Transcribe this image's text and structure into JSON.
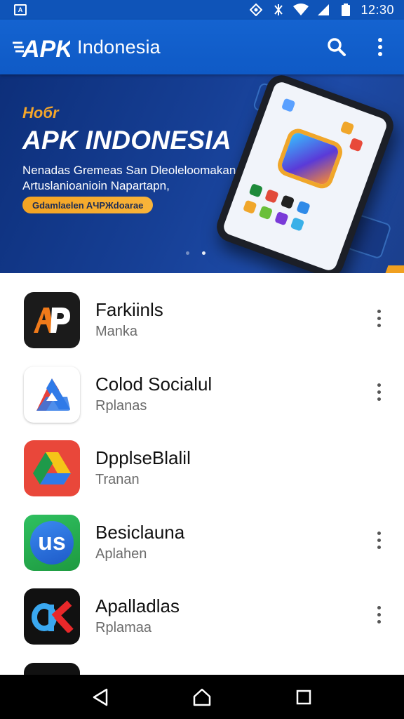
{
  "status_bar": {
    "notification_icon": "notification-icon",
    "time": "12:30",
    "icons": [
      "nfc-icon",
      "vibrate-icon",
      "wifi-icon",
      "signal-icon",
      "battery-icon"
    ]
  },
  "app_bar": {
    "logo": "APK",
    "title": "Indonesia",
    "actions": [
      "search-icon",
      "more-vert-icon"
    ]
  },
  "banner": {
    "tag": "Hoбr",
    "heading": "APK INDONESIA",
    "description_line1": "Nenadas Gremeas San Dleoleloomakan",
    "description_line2": "Artuslanioanioin Napartapn,",
    "cta": "Gdamlaelen AЧPЖdoarae",
    "page_indicator": {
      "pages": 2,
      "active": 2
    }
  },
  "apps": [
    {
      "name": "Farkiinls",
      "subtitle": "Manka",
      "icon": "ap-logo-icon"
    },
    {
      "name": "Colod Socialul",
      "subtitle": "Rplanas",
      "icon": "drive-triangle-icon"
    },
    {
      "name": "DpplseBlalil",
      "subtitle": "Tranan",
      "icon": "drive-triangle-red-icon"
    },
    {
      "name": "Besiclauna",
      "subtitle": "Aplahen",
      "icon": "us-logo-icon"
    },
    {
      "name": "Apalladlas",
      "subtitle": "Rplamaa",
      "icon": "ak-logo-icon"
    }
  ],
  "nav_bar": [
    "back-icon",
    "home-icon",
    "recents-icon"
  ],
  "colors": {
    "primary": "#1463d0",
    "status_bar": "#0f54b8",
    "accent": "#f4a322",
    "banner_dark": "#0d2f7a"
  }
}
